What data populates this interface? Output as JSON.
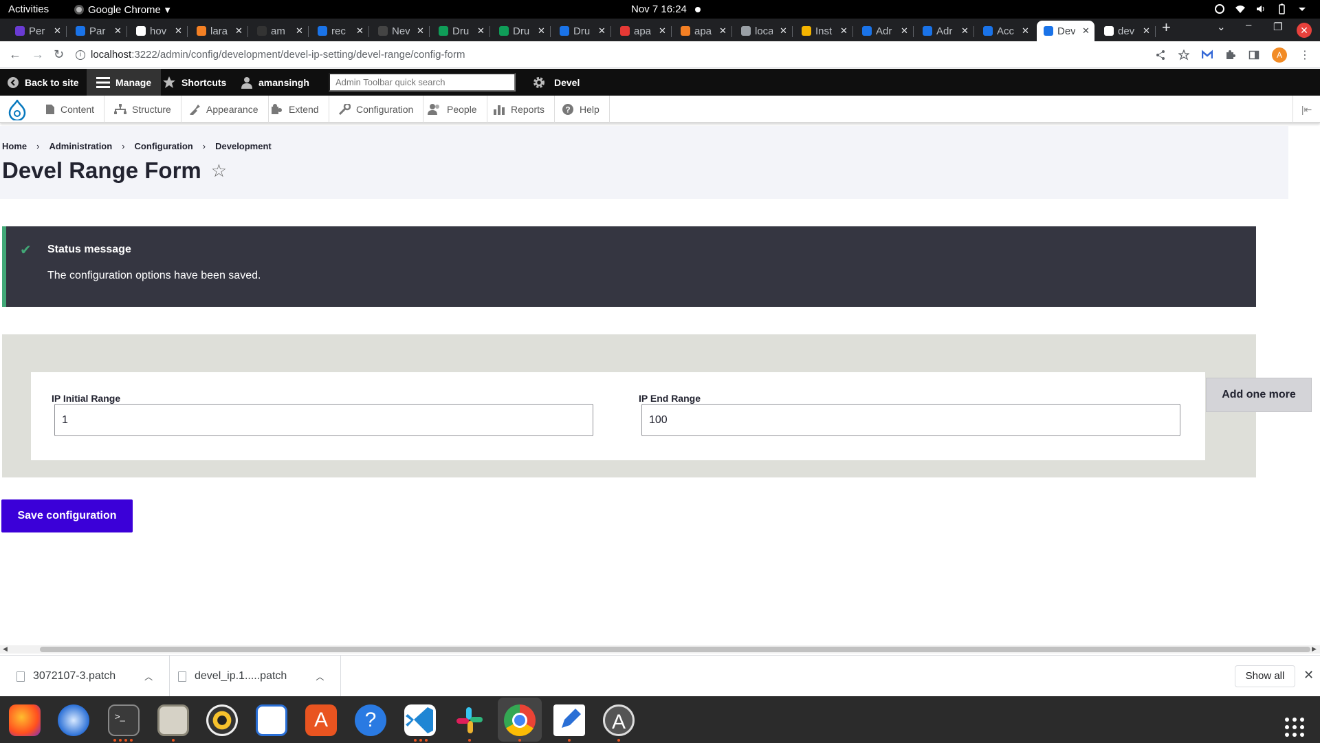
{
  "system": {
    "activities": "Activities",
    "app_name": "Google Chrome",
    "app_menu_caret": "▾",
    "datetime": "Nov 7  16:24"
  },
  "tabs": [
    {
      "title": "Per",
      "color": "#6a3bd3"
    },
    {
      "title": "Par",
      "color": "#1a73e8"
    },
    {
      "title": "hov",
      "color": "#ffffff"
    },
    {
      "title": "lara",
      "color": "#f48024"
    },
    {
      "title": "am",
      "color": "#333333"
    },
    {
      "title": "rec",
      "color": "#1a73e8"
    },
    {
      "title": "Nev",
      "color": "#444444"
    },
    {
      "title": "Dru",
      "color": "#0f9d58"
    },
    {
      "title": "Dru",
      "color": "#0f9d58"
    },
    {
      "title": "Dru",
      "color": "#1a73e8"
    },
    {
      "title": "apa",
      "color": "#e53935"
    },
    {
      "title": "apa",
      "color": "#f48024"
    },
    {
      "title": "loca",
      "color": "#9aa0a6"
    },
    {
      "title": "Inst",
      "color": "#f4b400"
    },
    {
      "title": "Adr",
      "color": "#1a73e8"
    },
    {
      "title": "Adr",
      "color": "#1a73e8"
    },
    {
      "title": "Acc",
      "color": "#1a73e8"
    },
    {
      "title": "Dev",
      "color": "#1a73e8",
      "active": true
    },
    {
      "title": "dev",
      "color": "#ffffff"
    }
  ],
  "address": {
    "host": "localhost",
    "path": ":3222/admin/config/development/devel-ip-setting/devel-range/config-form",
    "avatar_letter": "A"
  },
  "admin_toolbar": {
    "back": "Back to site",
    "manage": "Manage",
    "shortcuts": "Shortcuts",
    "user": "amansingh",
    "search_placeholder": "Admin Toolbar quick search",
    "devel": "Devel"
  },
  "menu": [
    "Content",
    "Structure",
    "Appearance",
    "Extend",
    "Configuration",
    "People",
    "Reports",
    "Help"
  ],
  "breadcrumb": [
    "Home",
    "Administration",
    "Configuration",
    "Development"
  ],
  "breadcrumb_sep": "›",
  "page_title": "Devel Range Form",
  "status": {
    "title": "Status message",
    "message": "The configuration options have been saved."
  },
  "form": {
    "initial_label": "IP Initial Range",
    "initial_value": "1",
    "end_label": "IP End Range",
    "end_value": "100",
    "add_more": "Add one more",
    "save": "Save configuration"
  },
  "downloads": [
    {
      "name": "3072107-3.patch"
    },
    {
      "name": "devel_ip.1.....patch"
    }
  ],
  "shelf": {
    "show_all": "Show all"
  }
}
